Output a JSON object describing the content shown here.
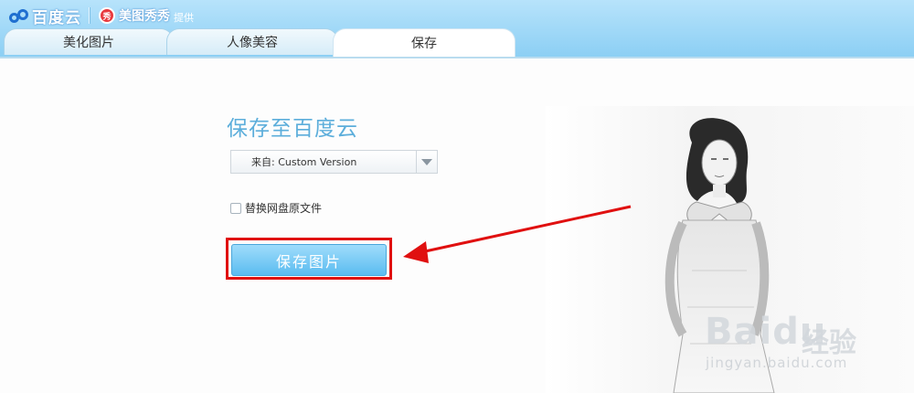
{
  "header": {
    "brand": "百度云",
    "partner": "美图秀秀",
    "partner_suffix": "提供",
    "partner_icon_glyph": "秀"
  },
  "tabs": [
    {
      "label": "美化图片",
      "active": false
    },
    {
      "label": "人像美容",
      "active": false
    },
    {
      "label": "保存",
      "active": true
    }
  ],
  "form": {
    "title": "保存至百度云",
    "select_value": "来自: Custom Version",
    "checkbox_label": "替换网盘原文件",
    "checkbox_checked": false,
    "save_button": "保存图片"
  },
  "watermark": {
    "brand": "Baidu",
    "cn": "经验",
    "url": "jingyan.baidu.com"
  },
  "colors": {
    "accent": "#5caedb",
    "highlight": "#e01010",
    "button": "#5bbcf0"
  }
}
